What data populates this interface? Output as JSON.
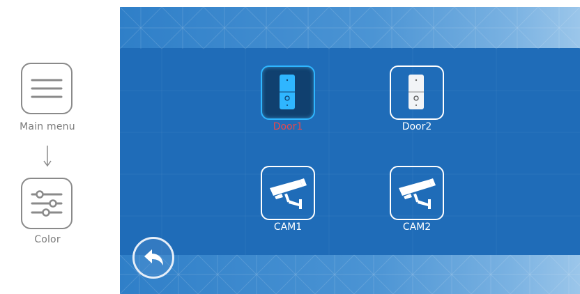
{
  "guide": {
    "main_menu_label": "Main menu",
    "color_label": "Color",
    "icons": [
      "hamburger-menu-icon",
      "sliders-icon",
      "arrow-down-icon"
    ]
  },
  "screen": {
    "tiles": [
      {
        "label": "Door1",
        "icon": "door-station-icon",
        "selected": true
      },
      {
        "label": "Door2",
        "icon": "door-station-icon",
        "selected": false
      },
      {
        "label": "CAM1",
        "icon": "security-camera-icon",
        "selected": false
      },
      {
        "label": "CAM2",
        "icon": "security-camera-icon",
        "selected": false
      }
    ],
    "back_icon": "back-arrow-icon"
  },
  "colors": {
    "screen_bg": "#1f6cb8",
    "selected_label": "#e8474c",
    "selected_border": "#2fb6ff",
    "label": "#ffffff"
  }
}
